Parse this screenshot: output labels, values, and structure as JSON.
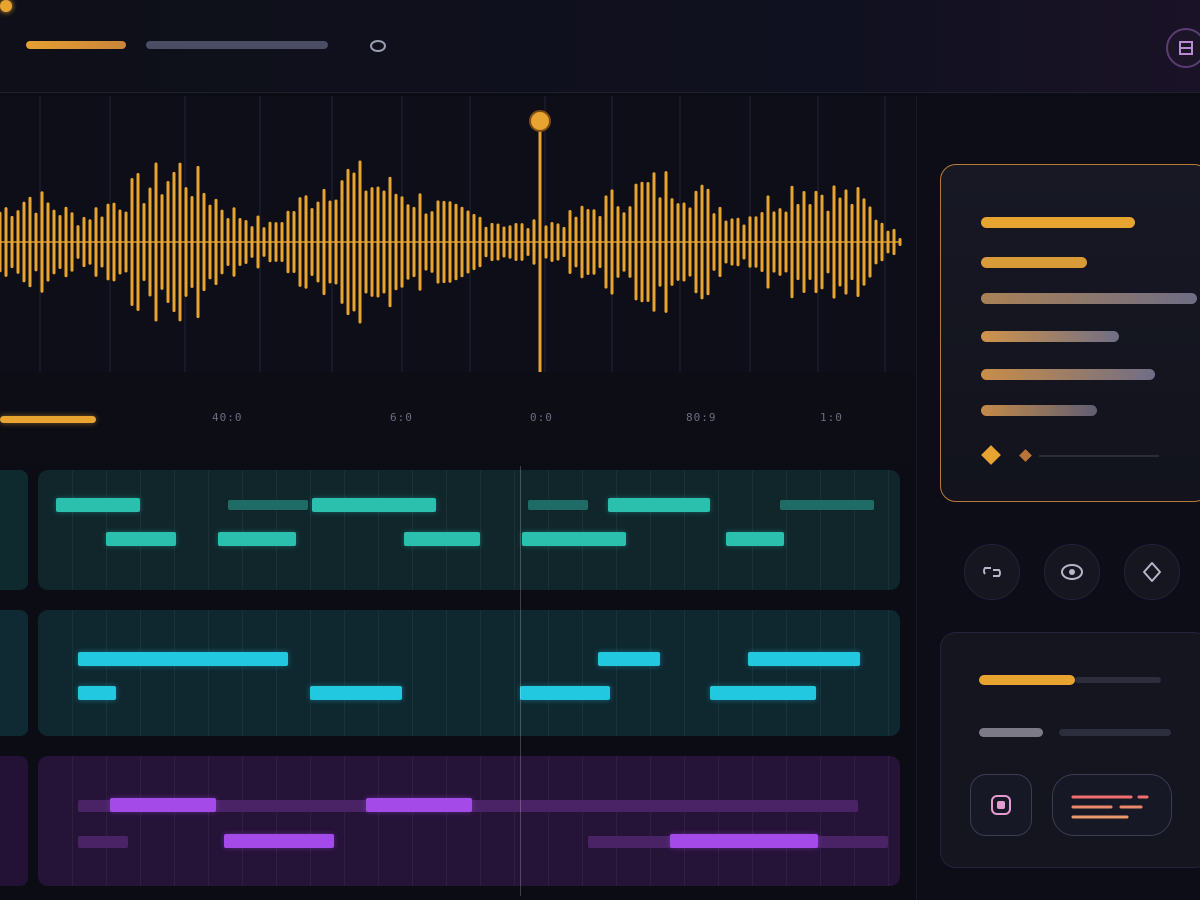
{
  "timeline": {
    "ticks": [
      "40:0",
      "6:0",
      "0:0",
      "80:9",
      "1:0"
    ]
  },
  "icons": {
    "top_small": "loop-icon",
    "top_right": "export-icon",
    "round_buttons": [
      "link-icon",
      "eye-icon",
      "settings-icon"
    ],
    "square_button": "square-icon",
    "lines_button": "list-icon"
  },
  "colors": {
    "accent_orange": "#e7a431",
    "teal": "#2bbfae",
    "cyan": "#22c7e0",
    "purple": "#a34ae8",
    "background": "#0b0c14"
  },
  "transport": {
    "playhead_progress": 0.59
  }
}
